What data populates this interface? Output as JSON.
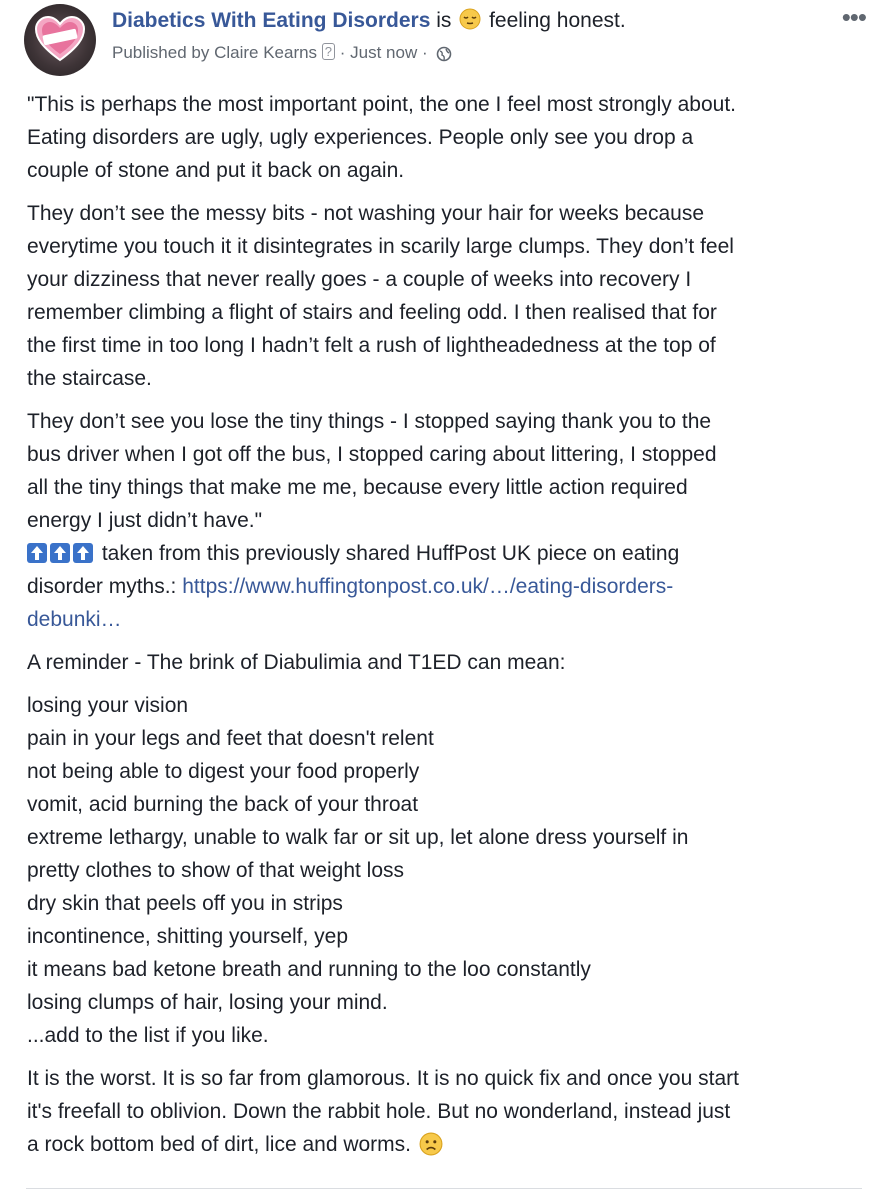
{
  "header": {
    "page_name": "Diabetics With Eating Disorders",
    "is_text": "is",
    "feeling_text": "feeling honest.",
    "published_by": "Published by Claire Kearns",
    "help_badge": "?",
    "timestamp": "· Just now ·",
    "more_label": "•••"
  },
  "post": {
    "p1": [
      "\"This is perhaps the most important point, the one I feel most strongly about.",
      "Eating disorders are ugly, ugly experiences. People only see you drop a",
      "couple of stone and put it back on again."
    ],
    "p2": [
      "They don’t see the messy bits - not washing your hair for weeks because",
      "everytime you touch it it disintegrates in scarily large clumps. They don’t feel",
      "your dizziness that never really goes - a couple of weeks into recovery I",
      "remember climbing a flight of stairs and feeling odd. I then realised that for",
      "the first time in too long I hadn’t felt a rush of lightheadedness at the top of",
      "the staircase."
    ],
    "p3": [
      "They don’t see you lose the tiny things - I stopped saying thank you to the",
      "bus driver when I got off the bus, I stopped caring about littering, I stopped",
      "all the tiny things that make me me, because every little action required",
      "energy I just didn’t have.\""
    ],
    "source_text": "taken from this previously shared HuffPost UK piece on eating",
    "source_line2": "disorder myths.: ",
    "link_part1": "https://www.huffingtonpost.co.uk/…/eating-disorders-",
    "link_part2": "debunki…",
    "reminder": "A reminder - The brink of Diabulimia and T1ED can mean:",
    "list": [
      "losing your vision",
      "pain in your legs and feet that doesn't relent",
      "not being able to digest your food properly",
      "vomit, acid burning the back of your throat",
      "extreme lethargy, unable to walk far or sit up, let alone dress yourself in",
      "pretty clothes to show of that weight loss",
      "dry skin that peels off you in strips",
      "incontinence, shitting yourself, yep",
      "it means bad ketone breath and running to the loo constantly",
      "losing clumps of hair, losing your mind.",
      "...add to the list if you like."
    ],
    "closing": [
      "It is the worst. It is so far from glamorous. It is no quick fix and once you start",
      "it's freefall to oblivion. Down the rabbit hole. But no wonderland, instead just",
      "a rock bottom bed of dirt, lice and worms."
    ]
  },
  "colors": {
    "link": "#385898",
    "text": "#1d2129",
    "meta": "#606770",
    "badge": "#3a72c9"
  },
  "icons": [
    "heart-logo-icon",
    "relieved-face-icon",
    "help-icon",
    "globe-icon",
    "more-icon",
    "up-arrow-icon",
    "sad-face-icon"
  ]
}
